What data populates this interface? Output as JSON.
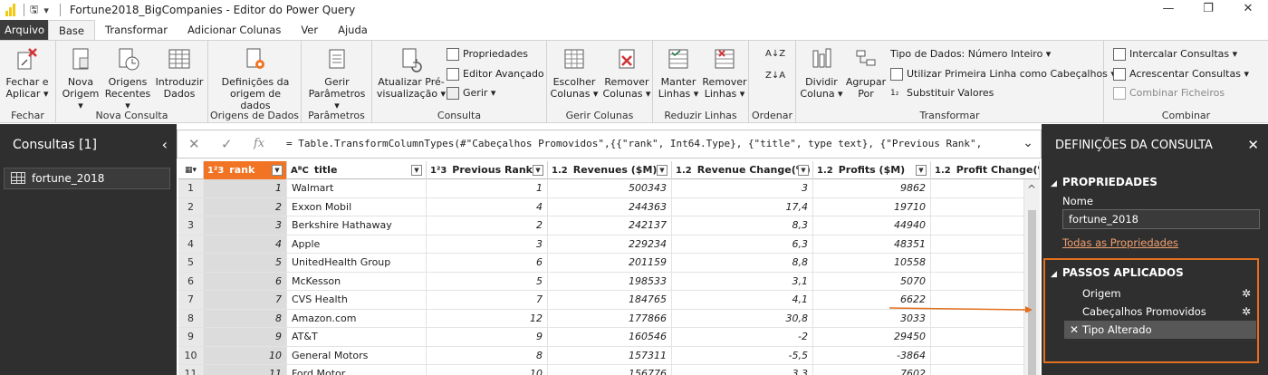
{
  "window": {
    "title": "Fortune2018_BigCompanies - Editor do Power Query",
    "controls": [
      "—",
      "❐",
      "✕"
    ]
  },
  "tabs": [
    {
      "label": "Arquivo"
    },
    {
      "label": "Base"
    },
    {
      "label": "Transformar"
    },
    {
      "label": "Adicionar Colunas"
    },
    {
      "label": "Ver"
    },
    {
      "label": "Ajuda"
    }
  ],
  "ribbon": {
    "groups": {
      "fechar": "Fechar",
      "nova_consulta": "Nova Consulta",
      "origens_dados": "Origens de Dados",
      "parametros": "Parâmetros",
      "consulta": "Consulta",
      "gerir_colunas": "Gerir Colunas",
      "reduzir_linhas": "Reduzir Linhas",
      "ordenar": "Ordenar",
      "transformar": "Transformar",
      "combinar": "Combinar"
    },
    "buttons": {
      "fechar_aplicar": "Fechar e Aplicar ▾",
      "nova_origem": "Nova Origem ▾",
      "origens_recentes": "Origens Recentes ▾",
      "introduzir_dados": "Introduzir Dados",
      "definicoes_origem": "Definições da origem de dados",
      "gerir_parametros": "Gerir Parâmetros ▾",
      "atualizar": "Atualizar Pré-visualização ▾",
      "propriedades": "Propriedades",
      "editor_avancado": "Editor Avançado",
      "gerir": "Gerir ▾",
      "escolher_colunas": "Escolher Colunas ▾",
      "remover_colunas": "Remover Colunas ▾",
      "manter_linhas": "Manter Linhas ▾",
      "remover_linhas": "Remover Linhas ▾",
      "dividir_coluna": "Dividir Coluna ▾",
      "agrupar_por": "Agrupar Por",
      "tipo_dados": "Tipo de Dados: Número Inteiro ▾",
      "primeira_linha": "Utilizar Primeira Linha como Cabeçalhos ▾",
      "substituir_valores": "Substituir Valores",
      "intercalar": "Intercalar Consultas ▾",
      "acrescentar": "Acrescentar Consultas ▾",
      "combinar_ficheiros": "Combinar Ficheiros"
    }
  },
  "queries_panel": {
    "header": "Consultas [1]",
    "items": [
      {
        "label": "fortune_2018"
      }
    ]
  },
  "formula_bar": {
    "formula": "= Table.TransformColumnTypes(#\"Cabeçalhos Promovidos\",{{\"rank\", Int64.Type}, {\"title\", type text}, {\"Previous Rank\","
  },
  "table": {
    "columns": [
      {
        "type": "1²3",
        "name": "rank"
      },
      {
        "type": "AᴮC",
        "name": "title"
      },
      {
        "type": "1²3",
        "name": "Previous Rank"
      },
      {
        "type": "1.2",
        "name": "Revenues ($M)"
      },
      {
        "type": "1.2",
        "name": "Revenue Change(%)"
      },
      {
        "type": "1.2",
        "name": "Profits ($M)"
      },
      {
        "type": "1.2",
        "name": "Profit Change(%)"
      }
    ],
    "rows": [
      [
        "1",
        "1",
        "Walmart",
        "1",
        "500343",
        "3",
        "9862"
      ],
      [
        "2",
        "2",
        "Exxon Mobil",
        "4",
        "244363",
        "17,4",
        "19710"
      ],
      [
        "3",
        "3",
        "Berkshire Hathaway",
        "2",
        "242137",
        "8,3",
        "44940"
      ],
      [
        "4",
        "4",
        "Apple",
        "3",
        "229234",
        "6,3",
        "48351"
      ],
      [
        "5",
        "5",
        "UnitedHealth Group",
        "6",
        "201159",
        "8,8",
        "10558"
      ],
      [
        "6",
        "6",
        "McKesson",
        "5",
        "198533",
        "3,1",
        "5070"
      ],
      [
        "7",
        "7",
        "CVS Health",
        "7",
        "184765",
        "4,1",
        "6622"
      ],
      [
        "8",
        "8",
        "Amazon.com",
        "12",
        "177866",
        "30,8",
        "3033"
      ],
      [
        "9",
        "9",
        "AT&T",
        "9",
        "160546",
        "-2",
        "29450"
      ],
      [
        "10",
        "10",
        "General Motors",
        "8",
        "157311",
        "-5,5",
        "-3864"
      ],
      [
        "11",
        "11",
        "Ford Motor",
        "10",
        "156776",
        "3,3",
        "7602"
      ]
    ]
  },
  "settings_panel": {
    "header": "DEFINIÇÕES DA CONSULTA",
    "properties_title": "PROPRIEDADES",
    "name_label": "Nome",
    "name_value": "fortune_2018",
    "all_properties": "Todas as Propriedades",
    "steps_title": "PASSOS APLICADOS",
    "steps": [
      {
        "label": "Origem",
        "gear": true
      },
      {
        "label": "Cabeçalhos Promovidos",
        "gear": true
      },
      {
        "label": "Tipo Alterado",
        "gear": false
      }
    ]
  },
  "colors": {
    "accent": "#f07423",
    "highlight_box": "#e2701e",
    "panel_bg": "#2f2f2f"
  }
}
